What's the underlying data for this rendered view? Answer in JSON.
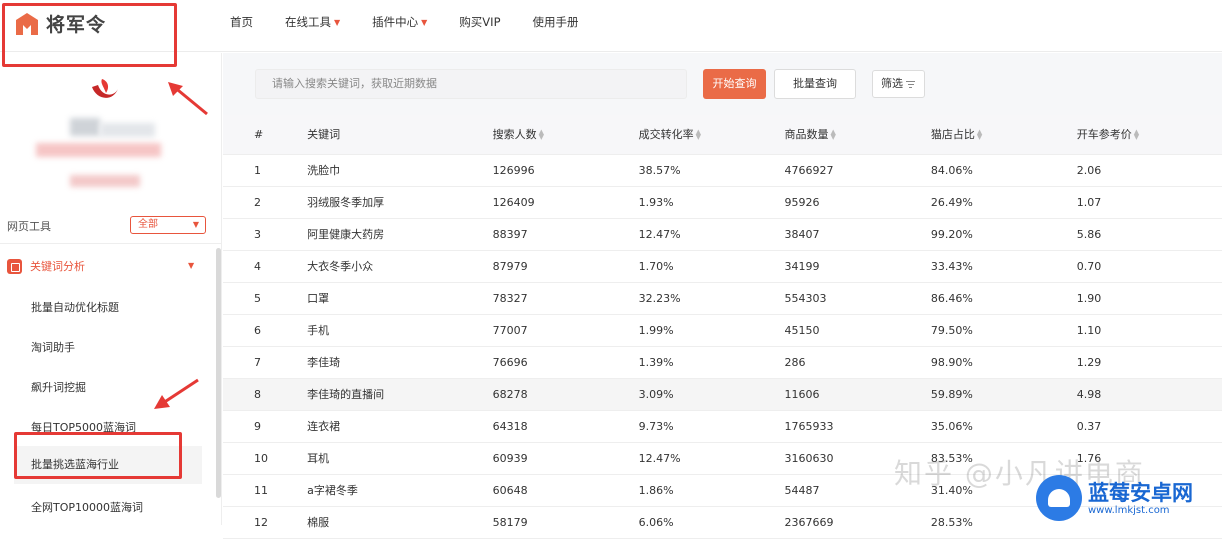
{
  "header": {
    "logo_text": "将军令",
    "nav": [
      {
        "label": "首页",
        "has_caret": false
      },
      {
        "label": "在线工具",
        "has_caret": true
      },
      {
        "label": "插件中心",
        "has_caret": true
      },
      {
        "label": "购买VIP",
        "has_caret": false
      },
      {
        "label": "使用手册",
        "has_caret": false
      }
    ]
  },
  "sidebar": {
    "web_tools_label": "网页工具",
    "filter_select": "全部",
    "category": "关键词分析",
    "items": [
      "批量自动优化标题",
      "淘词助手",
      "飙升词挖掘",
      "每日TOP5000蓝海词",
      "批量挑选蓝海行业",
      "全网TOP10000蓝海词"
    ],
    "highlighted_index": 4
  },
  "toolbar": {
    "search_placeholder": "请输入搜索关键词，获取近期数据",
    "start_query": "开始查询",
    "batch_query": "批量查询",
    "filter": "筛选"
  },
  "table": {
    "columns": [
      "#",
      "关键词",
      "搜索人数",
      "成交转化率",
      "商品数量",
      "猫店占比",
      "开车参考价"
    ],
    "sortable": [
      false,
      false,
      true,
      true,
      true,
      true,
      true
    ],
    "rows": [
      [
        "1",
        "洗脸巾",
        "126996",
        "38.57%",
        "4766927",
        "84.06%",
        "2.06"
      ],
      [
        "2",
        "羽绒服冬季加厚",
        "126409",
        "1.93%",
        "95926",
        "26.49%",
        "1.07"
      ],
      [
        "3",
        "阿里健康大药房",
        "88397",
        "12.47%",
        "38407",
        "99.20%",
        "5.86"
      ],
      [
        "4",
        "大衣冬季小众",
        "87979",
        "1.70%",
        "34199",
        "33.43%",
        "0.70"
      ],
      [
        "5",
        "口罩",
        "78327",
        "32.23%",
        "554303",
        "86.46%",
        "1.90"
      ],
      [
        "6",
        "手机",
        "77007",
        "1.99%",
        "45150",
        "79.50%",
        "1.10"
      ],
      [
        "7",
        "李佳琦",
        "76696",
        "1.39%",
        "286",
        "98.90%",
        "1.29"
      ],
      [
        "8",
        "李佳琦的直播间",
        "68278",
        "3.09%",
        "11606",
        "59.89%",
        "4.98"
      ],
      [
        "9",
        "连衣裙",
        "64318",
        "9.73%",
        "1765933",
        "35.06%",
        "0.37"
      ],
      [
        "10",
        "耳机",
        "60939",
        "12.47%",
        "3160630",
        "83.53%",
        "1.76"
      ],
      [
        "11",
        "a字裙冬季",
        "60648",
        "1.86%",
        "54487",
        "31.40%",
        ""
      ],
      [
        "12",
        "棉服",
        "58179",
        "6.06%",
        "2367669",
        "28.53%",
        ""
      ]
    ],
    "hover_row": 7
  },
  "overlay": {
    "watermark": "知乎 @小凡讲电商",
    "brand_title": "蓝莓安卓网",
    "brand_url": "www.lmkjst.com"
  },
  "colors": {
    "accent": "#ea6b47",
    "annotation": "#e53935",
    "brand": "#1967d2"
  }
}
